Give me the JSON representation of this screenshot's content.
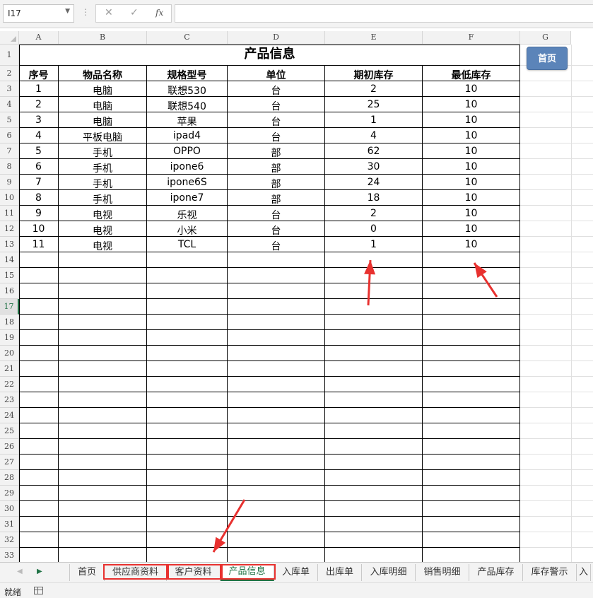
{
  "formula_bar": {
    "name_box": "I17",
    "fx_label": "fx",
    "formula": ""
  },
  "columns": [
    "A",
    "B",
    "C",
    "D",
    "E",
    "F",
    "G"
  ],
  "active_row": 17,
  "sheet": {
    "title": "产品信息",
    "headers": [
      "序号",
      "物品名称",
      "规格型号",
      "单位",
      "期初库存",
      "最低库存"
    ],
    "rows": [
      [
        "1",
        "电脑",
        "联想530",
        "台",
        "2",
        "10"
      ],
      [
        "2",
        "电脑",
        "联想540",
        "台",
        "25",
        "10"
      ],
      [
        "3",
        "电脑",
        "苹果",
        "台",
        "1",
        "10"
      ],
      [
        "4",
        "平板电脑",
        "ipad4",
        "台",
        "4",
        "10"
      ],
      [
        "5",
        "手机",
        "OPPO",
        "部",
        "62",
        "10"
      ],
      [
        "6",
        "手机",
        "ipone6",
        "部",
        "30",
        "10"
      ],
      [
        "7",
        "手机",
        "ipone6S",
        "部",
        "24",
        "10"
      ],
      [
        "8",
        "手机",
        "ipone7",
        "部",
        "18",
        "10"
      ],
      [
        "9",
        "电视",
        "乐视",
        "台",
        "2",
        "10"
      ],
      [
        "10",
        "电视",
        "小米",
        "台",
        "0",
        "10"
      ],
      [
        "11",
        "电视",
        "TCL",
        "台",
        "1",
        "10"
      ]
    ]
  },
  "home_button": "首页",
  "tabs": [
    "首页",
    "供应商资料",
    "客户资料",
    "产品信息",
    "入库单",
    "出库单",
    "入库明细",
    "销售明细",
    "产品库存",
    "库存警示",
    "入"
  ],
  "active_tab": "产品信息",
  "status": "就绪",
  "annotation_color": "#e8312f"
}
